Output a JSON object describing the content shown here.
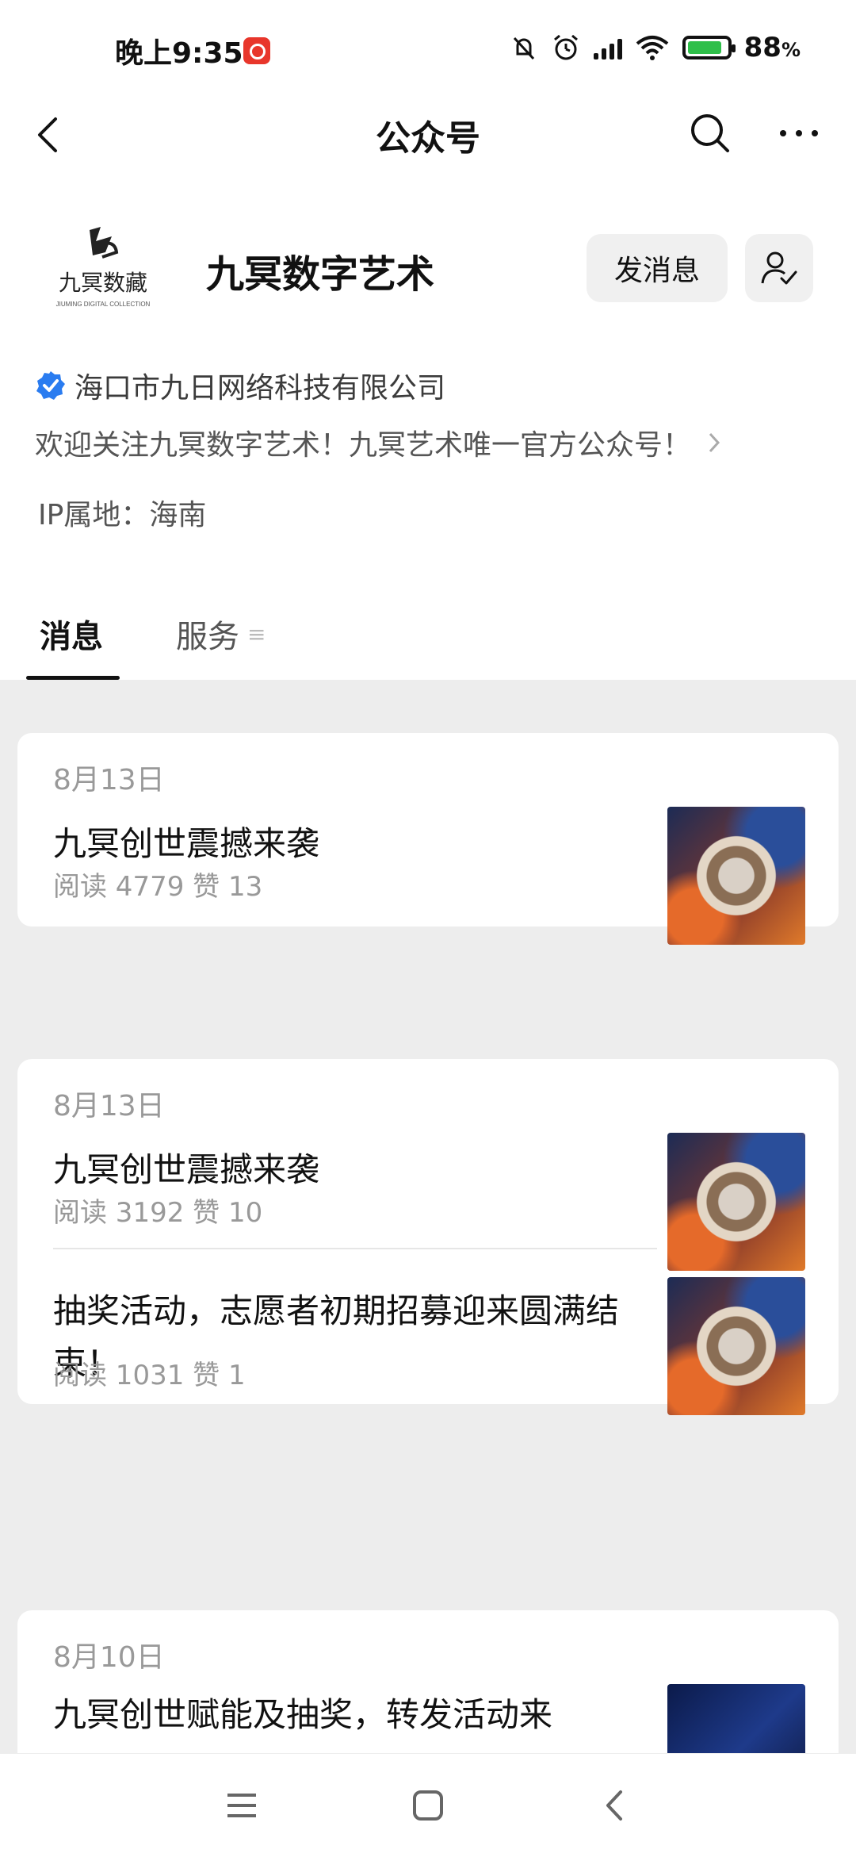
{
  "status_bar": {
    "time": "晚上9:35",
    "battery_percent": "88",
    "battery_unit": "%"
  },
  "header": {
    "title": "公众号"
  },
  "profile": {
    "logo_text": "九冥数藏",
    "logo_subtext": "JIUMING DIGITAL COLLECTION",
    "name": "九冥数字艺术",
    "send_message_label": "发消息",
    "verified_company": "海口市九日网络科技有限公司",
    "description": "欢迎关注九冥数字艺术！九冥艺术唯一官方公众号！",
    "ip_location": "IP属地：海南"
  },
  "tabs": {
    "messages": "消息",
    "services": "服务"
  },
  "feed": [
    {
      "date": "8月13日",
      "articles": [
        {
          "title": "九冥创世震撼来袭",
          "meta": "阅读 4779   赞 13"
        }
      ]
    },
    {
      "date": "8月13日",
      "articles": [
        {
          "title": "九冥创世震撼来袭",
          "meta": "阅读 3192   赞 10"
        },
        {
          "title": "抽奖活动，志愿者初期招募迎来圆满结束！",
          "meta": "阅读 1031   赞 1"
        }
      ]
    },
    {
      "date": "8月10日",
      "articles": [
        {
          "title": "九冥创世赋能及抽奖，转发活动来",
          "meta": ""
        }
      ]
    }
  ],
  "colors": {
    "verify_blue": "#2a7cf0",
    "feed_background": "#ededed",
    "battery_green": "#2fbf4a"
  },
  "icons": [
    "back-icon",
    "search-icon",
    "more-icon",
    "follow-settings-icon",
    "verified-icon",
    "chevron-right-icon",
    "menu-icon",
    "home-icon",
    "back-nav-icon"
  ]
}
